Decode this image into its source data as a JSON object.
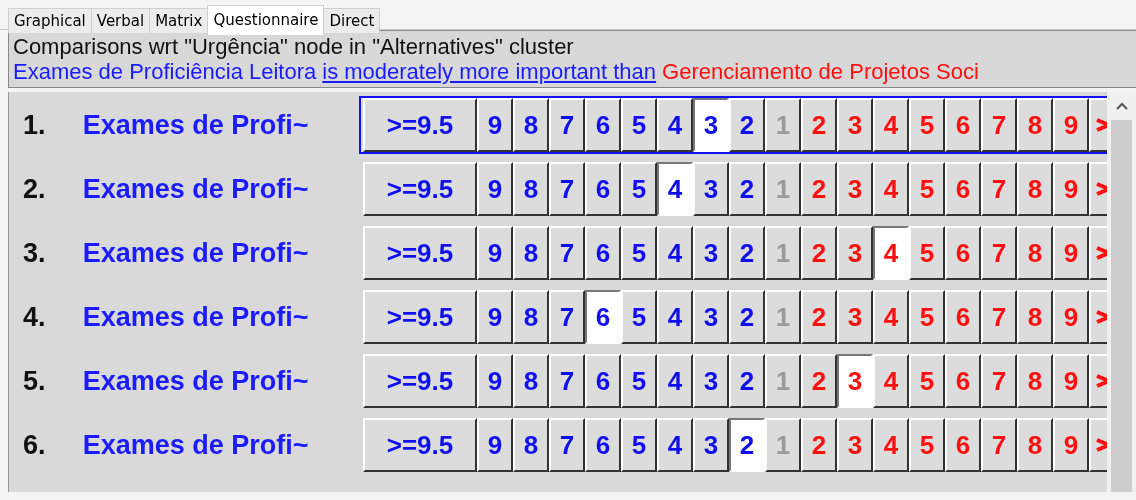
{
  "tabs": [
    {
      "label": "Graphical",
      "selected": false
    },
    {
      "label": "Verbal",
      "selected": false
    },
    {
      "label": "Matrix",
      "selected": false
    },
    {
      "label": "Questionnaire",
      "selected": true
    },
    {
      "label": "Direct",
      "selected": false
    }
  ],
  "header": {
    "title": "Comparisons wrt \"Urgência\" node in \"Alternatives\" cluster",
    "left_node": "Exames de Proficiência Leitora",
    "verdict_link": "is moderately more important than",
    "right_node": "Gerenciamento de Projetos Soci"
  },
  "rows": [
    {
      "number": "1.",
      "label": "Exames de Profi~",
      "focused": true,
      "buttons": [
        {
          "label": ">=9.5",
          "kind": "left",
          "selected": false
        },
        {
          "label": "9",
          "kind": "left",
          "selected": false
        },
        {
          "label": "8",
          "kind": "left",
          "selected": false
        },
        {
          "label": "7",
          "kind": "left",
          "selected": false
        },
        {
          "label": "6",
          "kind": "left",
          "selected": false
        },
        {
          "label": "5",
          "kind": "left",
          "selected": false
        },
        {
          "label": "4",
          "kind": "left",
          "selected": false
        },
        {
          "label": "3",
          "kind": "left",
          "selected": true
        },
        {
          "label": "2",
          "kind": "left",
          "selected": false
        },
        {
          "label": "1",
          "kind": "equal",
          "selected": false
        },
        {
          "label": "2",
          "kind": "right",
          "selected": false
        },
        {
          "label": "3",
          "kind": "right",
          "selected": false
        },
        {
          "label": "4",
          "kind": "right",
          "selected": false
        },
        {
          "label": "5",
          "kind": "right",
          "selected": false
        },
        {
          "label": "6",
          "kind": "right",
          "selected": false
        },
        {
          "label": "7",
          "kind": "right",
          "selected": false
        },
        {
          "label": "8",
          "kind": "right",
          "selected": false
        },
        {
          "label": "9",
          "kind": "right",
          "selected": false
        }
      ]
    },
    {
      "number": "2.",
      "label": "Exames de Profi~",
      "focused": false,
      "buttons": [
        {
          "label": ">=9.5",
          "kind": "left",
          "selected": false
        },
        {
          "label": "9",
          "kind": "left",
          "selected": false
        },
        {
          "label": "8",
          "kind": "left",
          "selected": false
        },
        {
          "label": "7",
          "kind": "left",
          "selected": false
        },
        {
          "label": "6",
          "kind": "left",
          "selected": false
        },
        {
          "label": "5",
          "kind": "left",
          "selected": false
        },
        {
          "label": "4",
          "kind": "left",
          "selected": true
        },
        {
          "label": "3",
          "kind": "left",
          "selected": false
        },
        {
          "label": "2",
          "kind": "left",
          "selected": false
        },
        {
          "label": "1",
          "kind": "equal",
          "selected": false
        },
        {
          "label": "2",
          "kind": "right",
          "selected": false
        },
        {
          "label": "3",
          "kind": "right",
          "selected": false
        },
        {
          "label": "4",
          "kind": "right",
          "selected": false
        },
        {
          "label": "5",
          "kind": "right",
          "selected": false
        },
        {
          "label": "6",
          "kind": "right",
          "selected": false
        },
        {
          "label": "7",
          "kind": "right",
          "selected": false
        },
        {
          "label": "8",
          "kind": "right",
          "selected": false
        },
        {
          "label": "9",
          "kind": "right",
          "selected": false
        }
      ]
    },
    {
      "number": "3.",
      "label": "Exames de Profi~",
      "focused": false,
      "buttons": [
        {
          "label": ">=9.5",
          "kind": "left",
          "selected": false
        },
        {
          "label": "9",
          "kind": "left",
          "selected": false
        },
        {
          "label": "8",
          "kind": "left",
          "selected": false
        },
        {
          "label": "7",
          "kind": "left",
          "selected": false
        },
        {
          "label": "6",
          "kind": "left",
          "selected": false
        },
        {
          "label": "5",
          "kind": "left",
          "selected": false
        },
        {
          "label": "4",
          "kind": "left",
          "selected": false
        },
        {
          "label": "3",
          "kind": "left",
          "selected": false
        },
        {
          "label": "2",
          "kind": "left",
          "selected": false
        },
        {
          "label": "1",
          "kind": "equal",
          "selected": false
        },
        {
          "label": "2",
          "kind": "right",
          "selected": false
        },
        {
          "label": "3",
          "kind": "right",
          "selected": false
        },
        {
          "label": "4",
          "kind": "right",
          "selected": true
        },
        {
          "label": "5",
          "kind": "right",
          "selected": false
        },
        {
          "label": "6",
          "kind": "right",
          "selected": false
        },
        {
          "label": "7",
          "kind": "right",
          "selected": false
        },
        {
          "label": "8",
          "kind": "right",
          "selected": false
        },
        {
          "label": "9",
          "kind": "right",
          "selected": false
        }
      ]
    },
    {
      "number": "4.",
      "label": "Exames de Profi~",
      "focused": false,
      "buttons": [
        {
          "label": ">=9.5",
          "kind": "left",
          "selected": false
        },
        {
          "label": "9",
          "kind": "left",
          "selected": false
        },
        {
          "label": "8",
          "kind": "left",
          "selected": false
        },
        {
          "label": "7",
          "kind": "left",
          "selected": false
        },
        {
          "label": "6",
          "kind": "left",
          "selected": true
        },
        {
          "label": "5",
          "kind": "left",
          "selected": false
        },
        {
          "label": "4",
          "kind": "left",
          "selected": false
        },
        {
          "label": "3",
          "kind": "left",
          "selected": false
        },
        {
          "label": "2",
          "kind": "left",
          "selected": false
        },
        {
          "label": "1",
          "kind": "equal",
          "selected": false
        },
        {
          "label": "2",
          "kind": "right",
          "selected": false
        },
        {
          "label": "3",
          "kind": "right",
          "selected": false
        },
        {
          "label": "4",
          "kind": "right",
          "selected": false
        },
        {
          "label": "5",
          "kind": "right",
          "selected": false
        },
        {
          "label": "6",
          "kind": "right",
          "selected": false
        },
        {
          "label": "7",
          "kind": "right",
          "selected": false
        },
        {
          "label": "8",
          "kind": "right",
          "selected": false
        },
        {
          "label": "9",
          "kind": "right",
          "selected": false
        }
      ]
    },
    {
      "number": "5.",
      "label": "Exames de Profi~",
      "focused": false,
      "buttons": [
        {
          "label": ">=9.5",
          "kind": "left",
          "selected": false
        },
        {
          "label": "9",
          "kind": "left",
          "selected": false
        },
        {
          "label": "8",
          "kind": "left",
          "selected": false
        },
        {
          "label": "7",
          "kind": "left",
          "selected": false
        },
        {
          "label": "6",
          "kind": "left",
          "selected": false
        },
        {
          "label": "5",
          "kind": "left",
          "selected": false
        },
        {
          "label": "4",
          "kind": "left",
          "selected": false
        },
        {
          "label": "3",
          "kind": "left",
          "selected": false
        },
        {
          "label": "2",
          "kind": "left",
          "selected": false
        },
        {
          "label": "1",
          "kind": "equal",
          "selected": false
        },
        {
          "label": "2",
          "kind": "right",
          "selected": false
        },
        {
          "label": "3",
          "kind": "right",
          "selected": true
        },
        {
          "label": "4",
          "kind": "right",
          "selected": false
        },
        {
          "label": "5",
          "kind": "right",
          "selected": false
        },
        {
          "label": "6",
          "kind": "right",
          "selected": false
        },
        {
          "label": "7",
          "kind": "right",
          "selected": false
        },
        {
          "label": "8",
          "kind": "right",
          "selected": false
        },
        {
          "label": "9",
          "kind": "right",
          "selected": false
        }
      ]
    },
    {
      "number": "6.",
      "label": "Exames de Profi~",
      "focused": false,
      "buttons": [
        {
          "label": ">=9.5",
          "kind": "left",
          "selected": false
        },
        {
          "label": "9",
          "kind": "left",
          "selected": false
        },
        {
          "label": "8",
          "kind": "left",
          "selected": false
        },
        {
          "label": "7",
          "kind": "left",
          "selected": false
        },
        {
          "label": "6",
          "kind": "left",
          "selected": false
        },
        {
          "label": "5",
          "kind": "left",
          "selected": false
        },
        {
          "label": "4",
          "kind": "left",
          "selected": false
        },
        {
          "label": "3",
          "kind": "left",
          "selected": false
        },
        {
          "label": "2",
          "kind": "left",
          "selected": true
        },
        {
          "label": "1",
          "kind": "equal",
          "selected": false
        },
        {
          "label": "2",
          "kind": "right",
          "selected": false
        },
        {
          "label": "3",
          "kind": "right",
          "selected": false
        },
        {
          "label": "4",
          "kind": "right",
          "selected": false
        },
        {
          "label": "5",
          "kind": "right",
          "selected": false
        },
        {
          "label": "6",
          "kind": "right",
          "selected": false
        },
        {
          "label": "7",
          "kind": "right",
          "selected": false
        },
        {
          "label": "8",
          "kind": "right",
          "selected": false
        },
        {
          "label": "9",
          "kind": "right",
          "selected": false
        }
      ]
    }
  ]
}
